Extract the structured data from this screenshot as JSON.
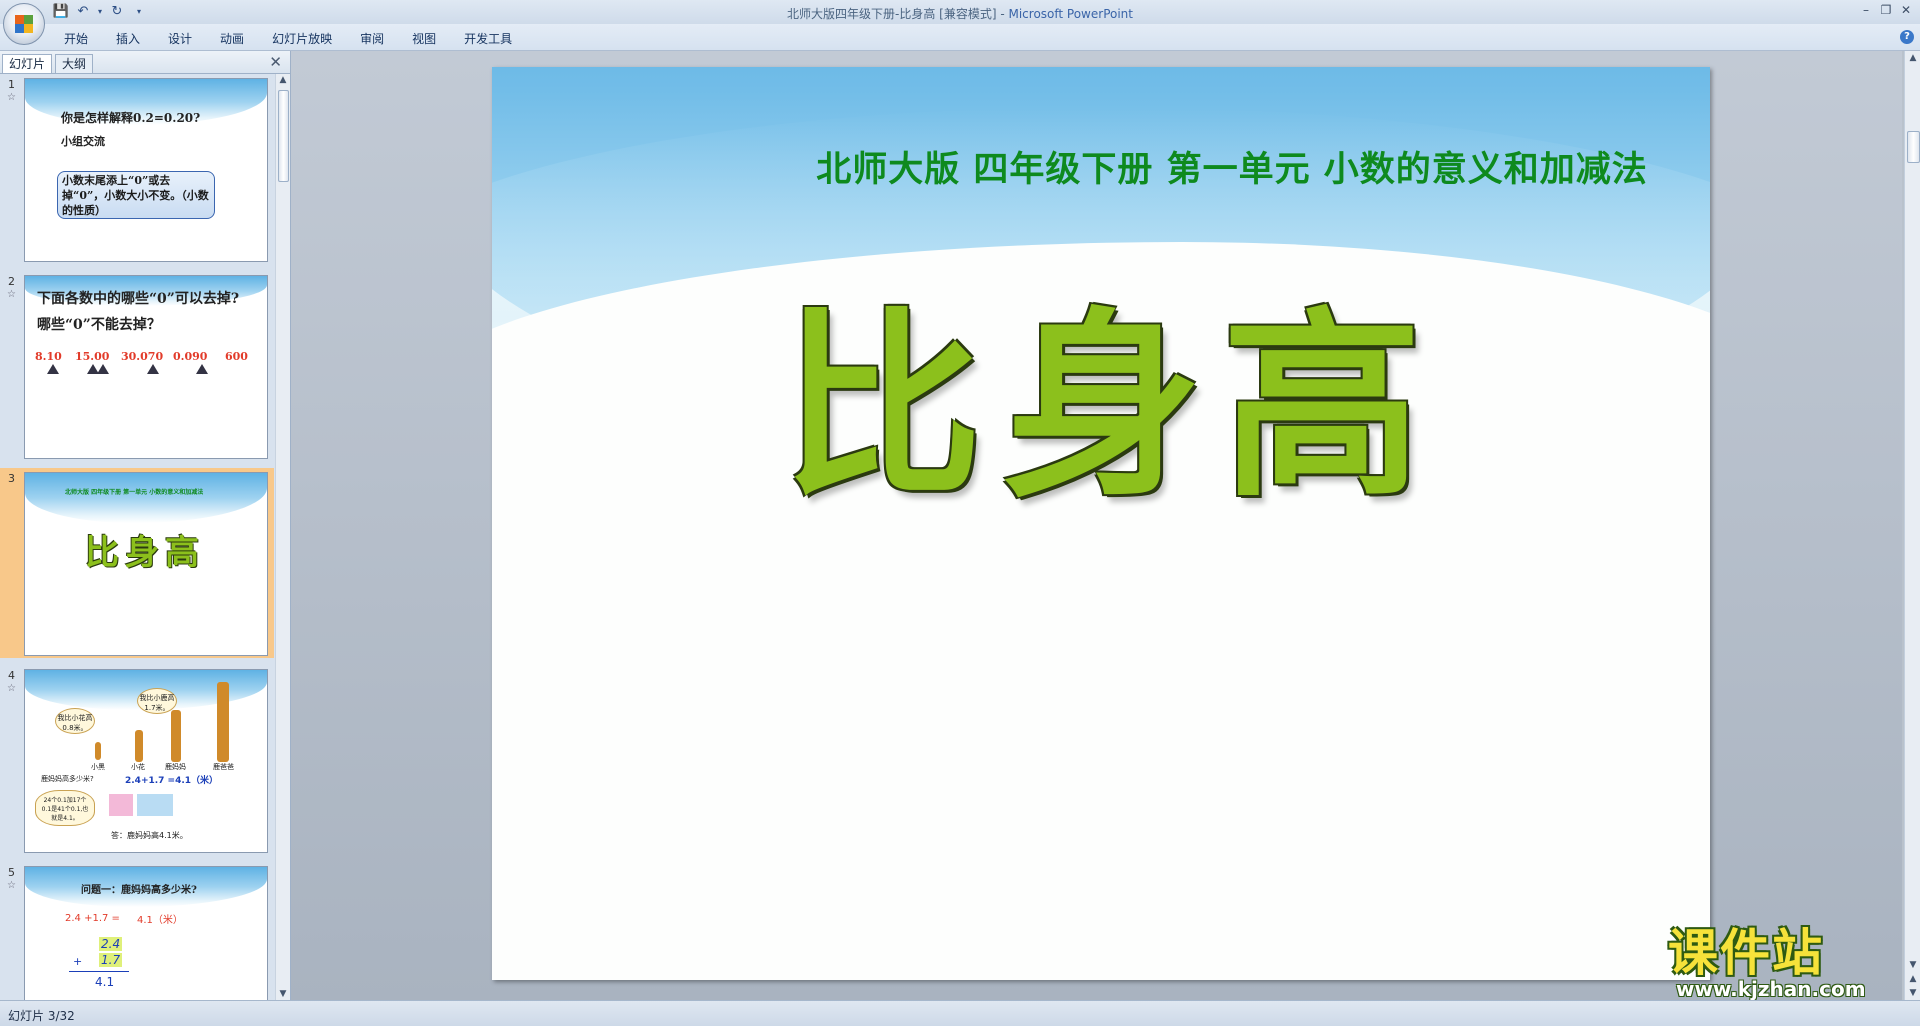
{
  "window": {
    "title_doc": "北师大版四年级下册-比身高 [兼容模式] - ",
    "title_app": "Microsoft PowerPoint"
  },
  "ribbon": {
    "tabs": [
      "开始",
      "插入",
      "设计",
      "动画",
      "幻灯片放映",
      "审阅",
      "视图",
      "开发工具"
    ]
  },
  "panel": {
    "tab_slides": "幻灯片",
    "tab_outline": "大纲"
  },
  "thumbnails": {
    "s1": {
      "num": "1",
      "question": "你是怎样解释0.2=0.20?",
      "group": "小组交流",
      "box_text": "小数末尾添上“0”或去掉“0”，小数大小不变。（小数的性质）"
    },
    "s2": {
      "num": "2",
      "line1": "下面各数中的哪些“0”可以去掉?",
      "line2": "哪些“0”不能去掉？",
      "numbers": [
        "8.10",
        "15.00",
        "30.070",
        "0.090",
        "600"
      ]
    },
    "s3": {
      "num": "3",
      "subtitle": "北师大版 四年级下册 第一单元 小数的意义和加减法",
      "title": "比身高"
    },
    "s4": {
      "num": "4",
      "bubble1": "我比小花高0.8米。",
      "bubble2": "我比小鹿高1.7米。",
      "names": [
        "小黑",
        "小花",
        "鹿妈妈",
        "鹿爸爸"
      ],
      "question": "鹿妈妈高多少米?",
      "equation": "2.4+1.7 =4.1（米）",
      "note": "24个0.1加17个0.1是41个0.1,也就是4.1。",
      "answer": "答：鹿妈妈高4.1米。"
    },
    "s5": {
      "num": "5",
      "question": "问题一：鹿妈妈高多少米?",
      "equation": "2.4 +1.7 =",
      "result": "4.1（米）",
      "top": "2.4",
      "mid": "1.7",
      "sum": "4.1"
    }
  },
  "slide": {
    "subtitle": "北师大版 四年级下册 第一单元 小数的意义和加减法",
    "title": "比身高"
  },
  "watermark": {
    "main": "课件站",
    "url": "www.kjzhan.com"
  },
  "status": {
    "slide_counter": "幻灯片 3/32"
  }
}
